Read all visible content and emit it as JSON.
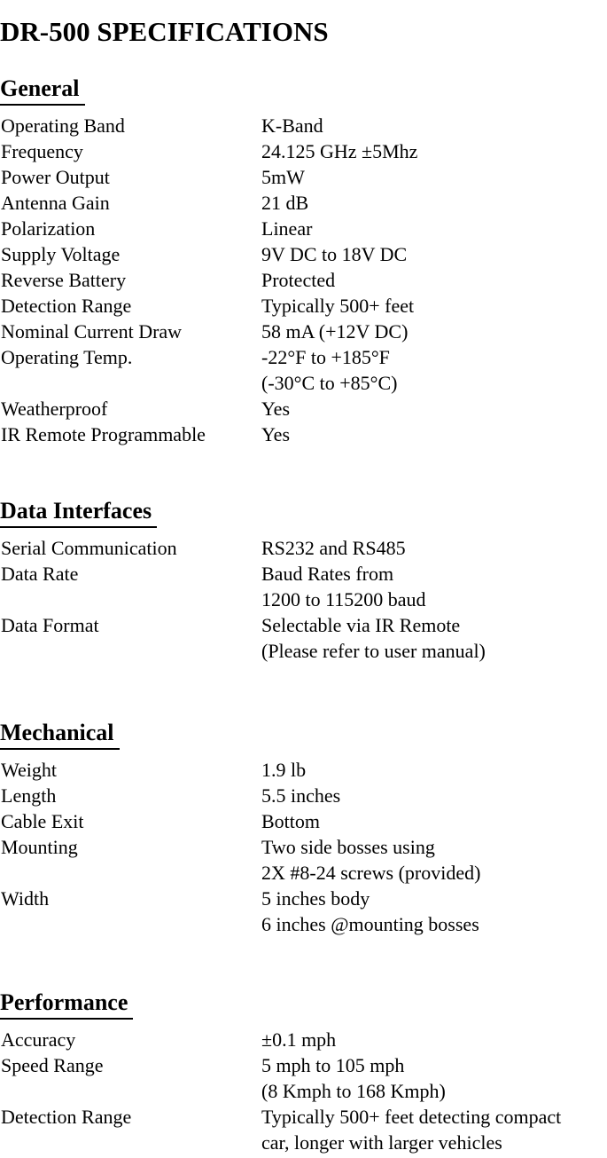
{
  "document": {
    "title": "DR-500 SPECIFICATIONS"
  },
  "sections": [
    {
      "heading": "General",
      "rows": [
        {
          "label": "Operating Band",
          "value": "K-Band"
        },
        {
          "label": "Frequency",
          "value": "24.125 GHz  ±5Mhz"
        },
        {
          "label": "Power Output",
          "value": "5mW"
        },
        {
          "label": "Antenna Gain",
          "value": "21 dB"
        },
        {
          "label": "Polarization",
          "value": "Linear"
        },
        {
          "label": "Supply Voltage",
          "value": "9V DC to 18V DC"
        },
        {
          "label": "Reverse Battery",
          "value": "Protected"
        },
        {
          "label": "Detection Range",
          "value": "Typically 500+ feet"
        },
        {
          "label": "Nominal Current Draw",
          "value": "58 mA (+12V DC)"
        },
        {
          "label": "Operating Temp.",
          "value": "-22°F to +185°F"
        },
        {
          "label": "",
          "value": "(-30°C to +85°C)"
        },
        {
          "label": "Weatherproof",
          "value": "Yes"
        },
        {
          "label": "IR Remote Programmable",
          "value": "Yes"
        }
      ]
    },
    {
      "heading": "Data Interfaces",
      "rows": [
        {
          "label": "Serial Communication",
          "value": "RS232 and RS485"
        },
        {
          "label": "Data Rate",
          "value": "Baud Rates from"
        },
        {
          "label": "",
          "value": "1200 to 115200 baud"
        },
        {
          "label": "Data Format",
          "value": "Selectable via IR Remote"
        },
        {
          "label": "",
          "value": "(Please refer to user manual)"
        }
      ]
    },
    {
      "heading": "Mechanical",
      "rows": [
        {
          "label": "Weight",
          "value": "1.9 lb"
        },
        {
          "label": "Length",
          "value": "5.5 inches"
        },
        {
          "label": "Cable Exit",
          "value": "Bottom"
        },
        {
          "label": "Mounting",
          "value": "Two side bosses using"
        },
        {
          "label": "",
          "value": "2X #8-24 screws (provided)"
        },
        {
          "label": "Width",
          "value": "5 inches body"
        },
        {
          "label": "",
          "value": "6 inches @mounting bosses"
        }
      ]
    },
    {
      "heading": "Performance",
      "rows": [
        {
          "label": "Accuracy",
          "value": "±0.1 mph"
        },
        {
          "label": "Speed Range",
          "value": "5 mph to 105 mph"
        },
        {
          "label": "",
          "value": "(8 Kmph to 168 Kmph)"
        },
        {
          "label": "Detection Range",
          "value": "Typically 500+ feet detecting compact"
        },
        {
          "label": "",
          "value": "car, longer with larger vehicles"
        }
      ]
    }
  ],
  "layout": {
    "section_heading_tops": [
      62,
      538,
      788,
      1092
    ],
    "section_rows_tops": [
      127,
      603,
      853,
      1157
    ]
  }
}
